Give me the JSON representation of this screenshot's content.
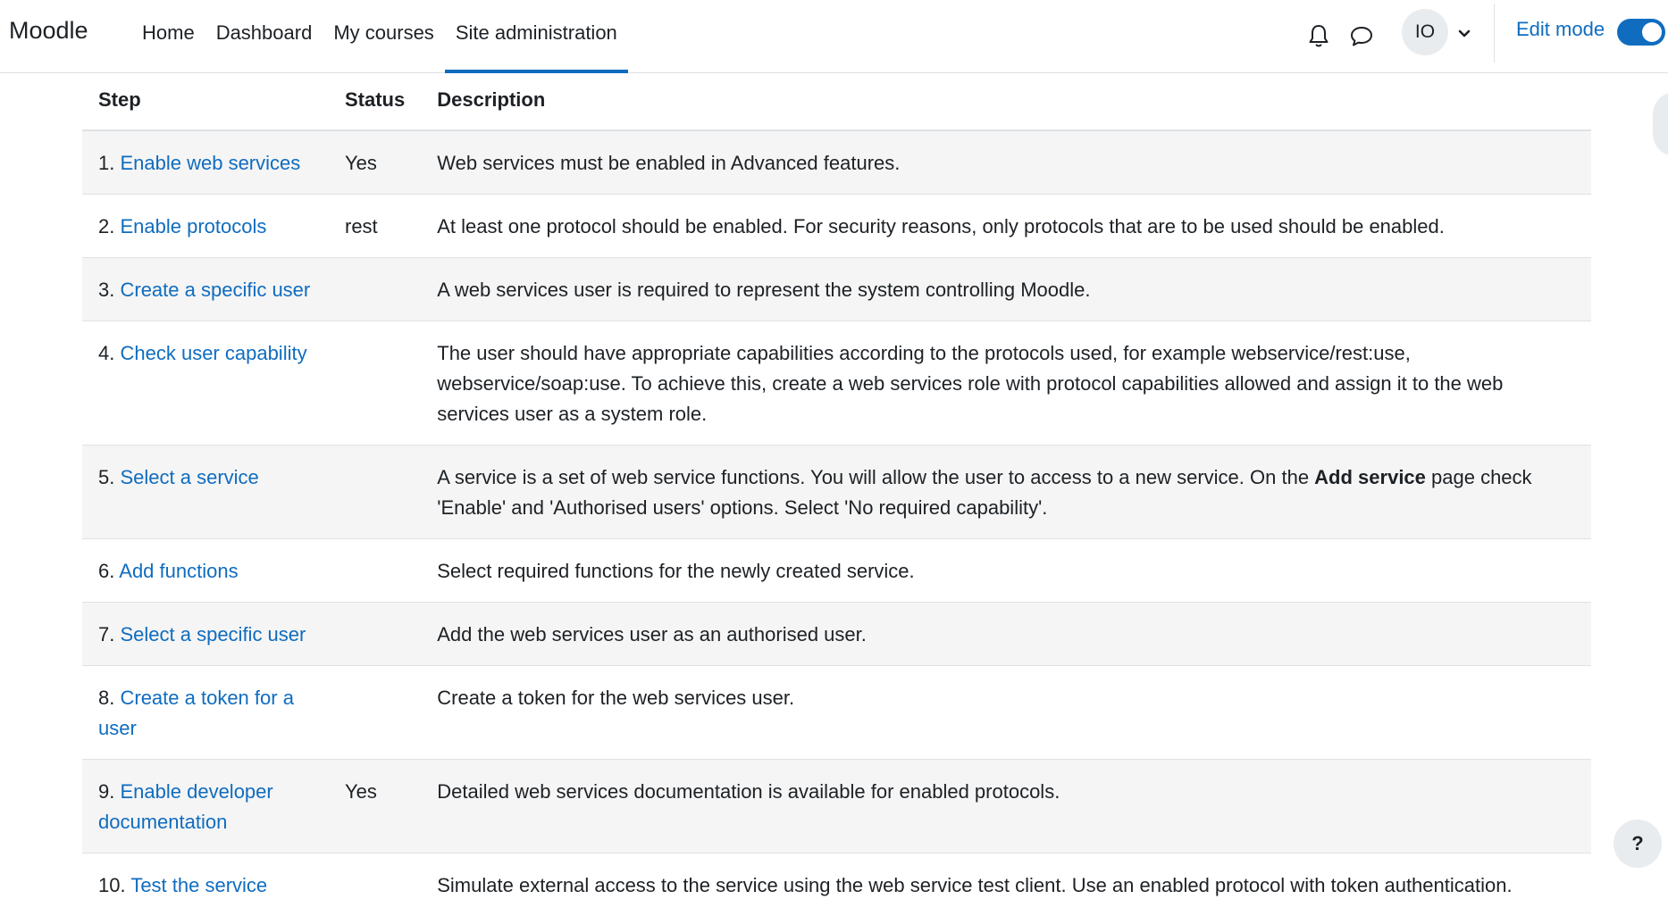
{
  "navbar": {
    "brand": "Moodle",
    "links": [
      "Home",
      "Dashboard",
      "My courses",
      "Site administration"
    ],
    "active_link": "Site administration",
    "avatar_initials": "IO",
    "edit_mode_label": "Edit mode",
    "edit_mode_on": true,
    "icons": [
      "bell-icon",
      "chat-bubble-icon",
      "chevron-down-icon"
    ]
  },
  "table": {
    "headers": {
      "step": "Step",
      "status": "Status",
      "description": "Description"
    },
    "rows": [
      {
        "num": "1.",
        "link": "Enable web services",
        "status": "Yes",
        "desc": "Web services must be enabled in Advanced features."
      },
      {
        "num": "2.",
        "link": "Enable protocols",
        "status": "rest",
        "desc": "At least one protocol should be enabled. For security reasons, only protocols that are to be used should be enabled."
      },
      {
        "num": "3.",
        "link": "Create a specific user",
        "status": "",
        "desc": "A web services user is required to represent the system controlling Moodle."
      },
      {
        "num": "4.",
        "link": "Check user capability",
        "status": "",
        "desc": "The user should have appropriate capabilities according to the protocols used, for example webservice/rest:use, webservice/soap:use. To achieve this, create a web services role with protocol capabilities allowed and assign it to the web services user as a system role."
      },
      {
        "num": "5.",
        "link": "Select a service",
        "status": "",
        "desc_before": "A service is a set of web service functions. You will allow the user to access to a new service. On the ",
        "desc_bold": "Add service",
        "desc_after": " page check 'Enable' and 'Authorised users' options. Select 'No required capability'."
      },
      {
        "num": "6.",
        "link": "Add functions",
        "status": "",
        "desc": "Select required functions for the newly created service."
      },
      {
        "num": "7.",
        "link": "Select a specific user",
        "status": "",
        "desc": "Add the web services user as an authorised user."
      },
      {
        "num": "8.",
        "link": "Create a token for a user",
        "status": "",
        "desc": "Create a token for the web services user."
      },
      {
        "num": "9.",
        "link": "Enable developer documentation",
        "status": "Yes",
        "desc": "Detailed web services documentation is available for enabled protocols."
      },
      {
        "num": "10.",
        "link": "Test the service",
        "status": "",
        "desc": "Simulate external access to the service using the web service test client. Use an enabled protocol with token authentication."
      }
    ]
  },
  "help_button": "?",
  "colors": {
    "link": "#0f6cbf",
    "stripe": "#f5f5f5",
    "border": "#dee2e6",
    "text": "#1d2125"
  }
}
